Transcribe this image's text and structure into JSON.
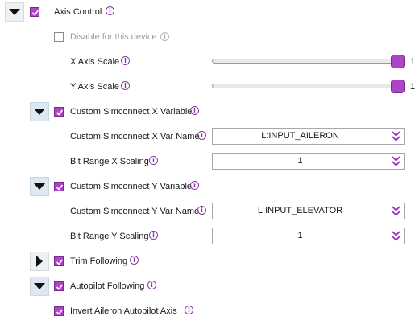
{
  "axis_control": {
    "label": "Axis Control",
    "expanded": true,
    "checked": true,
    "disable_device": {
      "label": "Disable for this device",
      "checked": false
    },
    "x_axis_scale": {
      "label": "X Axis Scale",
      "value": "1",
      "level": 1.0
    },
    "y_axis_scale": {
      "label": "Y Axis Scale",
      "value": "1",
      "level": 1.0
    }
  },
  "custom_x": {
    "label": "Custom Simconnect X Variable",
    "expanded": true,
    "checked": true,
    "var_name_label": "Custom Simconnect X Var Name",
    "var_name_value": "L:INPUT_AILERON",
    "bit_range_label": "Bit Range X Scaling",
    "bit_range_value": "1"
  },
  "custom_y": {
    "label": "Custom Simconnect Y Variable",
    "expanded": true,
    "checked": true,
    "var_name_label": "Custom Simconnect Y Var Name",
    "var_name_value": "L:INPUT_ELEVATOR",
    "bit_range_label": "Bit Range Y Scaling",
    "bit_range_value": "1"
  },
  "trim_following": {
    "label": "Trim Following",
    "expanded": false,
    "checked": true
  },
  "autopilot_following": {
    "label": "Autopilot Following",
    "expanded": true,
    "checked": true,
    "invert_aileron": {
      "label": "Invert Aileron Autopilot Axis",
      "checked": true
    }
  },
  "icons": {
    "info": "info-icon",
    "expand": "triangle-down-icon",
    "collapse": "triangle-right-icon",
    "spinner": "double-chevron-icon"
  },
  "colors": {
    "accent": "#b044c8",
    "toggle_bg": "#dde8f3"
  }
}
